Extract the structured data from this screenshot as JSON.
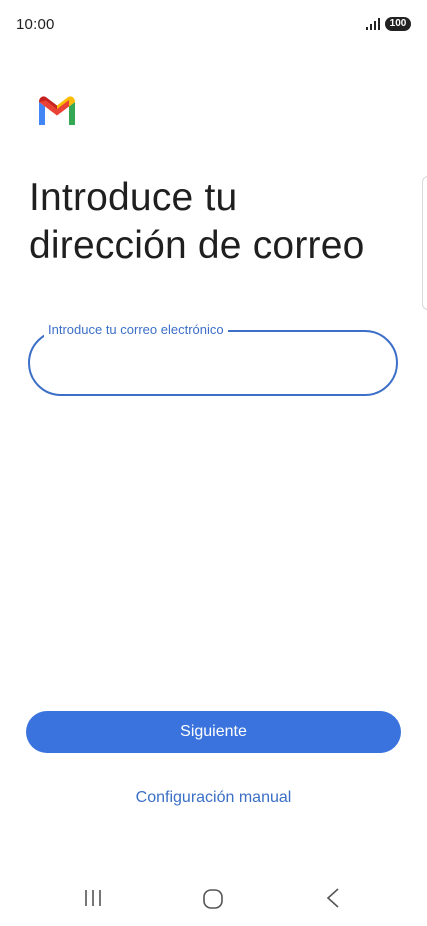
{
  "status_bar": {
    "time": "10:00",
    "battery": "100"
  },
  "main": {
    "title_line1": "Introduce tu",
    "title_line2": "dirección de correo",
    "email_field": {
      "label": "Introduce tu correo electrónico",
      "value": ""
    },
    "next_button": "Siguiente",
    "manual_setup": "Configuración manual"
  },
  "colors": {
    "accent": "#3a73dd",
    "field_border": "#3c6fc7",
    "link": "#3a6fc6",
    "gmail_red": "#ea4335",
    "gmail_blue": "#4285f4",
    "gmail_green": "#34a853",
    "gmail_yellow": "#fbbc04"
  },
  "icons": {
    "logo": "gmail-logo",
    "signal": "signal-icon",
    "nav_recents": "recents-icon",
    "nav_home": "home-icon",
    "nav_back": "back-icon"
  }
}
